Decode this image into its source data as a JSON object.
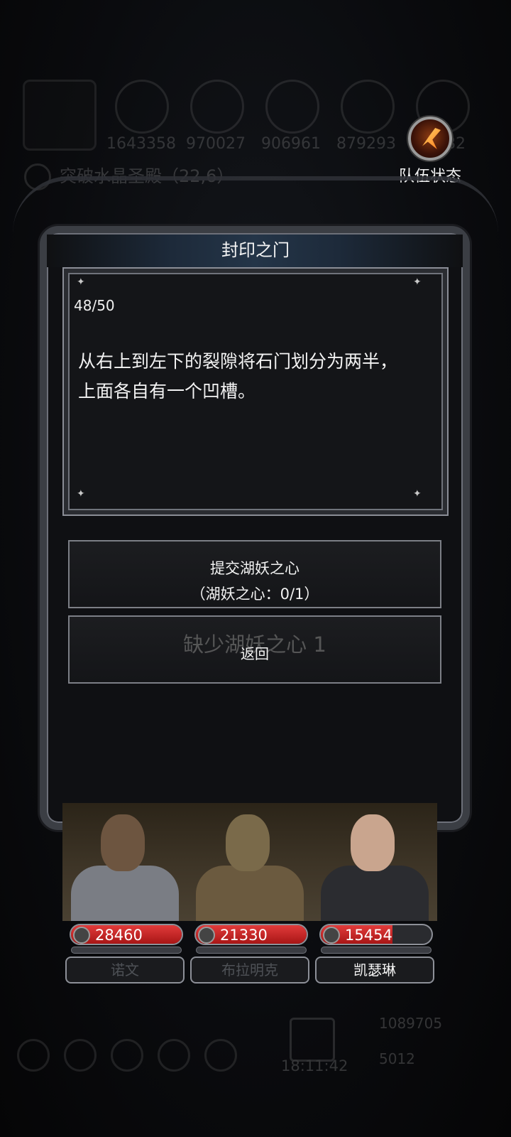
{
  "background_hud": {
    "resources": [
      "1643358",
      "970027",
      "906961",
      "879293",
      "482"
    ],
    "location": "突破水晶圣殿（22,6）",
    "time": "18:11:42",
    "gold": "1089705",
    "gems": "5012"
  },
  "team_status": {
    "label": "队伍状态",
    "icon": "fire-emblem-icon"
  },
  "dialog": {
    "title": "封印之门",
    "counter": "48/50",
    "text_line1": "从右上到左下的裂隙将石门划分为两半，",
    "text_line2": "上面各自有一个凹槽。"
  },
  "options": {
    "submit_line1": "提交湖妖之心",
    "submit_line2": "（湖妖之心：0/1）",
    "missing_label": "缺少湖妖之心 1",
    "back_label": "返回"
  },
  "party": [
    {
      "name": "诺文",
      "hp": "28460",
      "hp_fraction": 1.0,
      "active": false
    },
    {
      "name": "布拉明克",
      "hp": "21330",
      "hp_fraction": 1.0,
      "active": false
    },
    {
      "name": "凯瑟琳",
      "hp": "15454",
      "hp_fraction": 0.65,
      "active": true
    }
  ],
  "colors": {
    "hp_red": "#c21f1f",
    "frame": "#3b3e44",
    "header_blue": "#243548"
  }
}
